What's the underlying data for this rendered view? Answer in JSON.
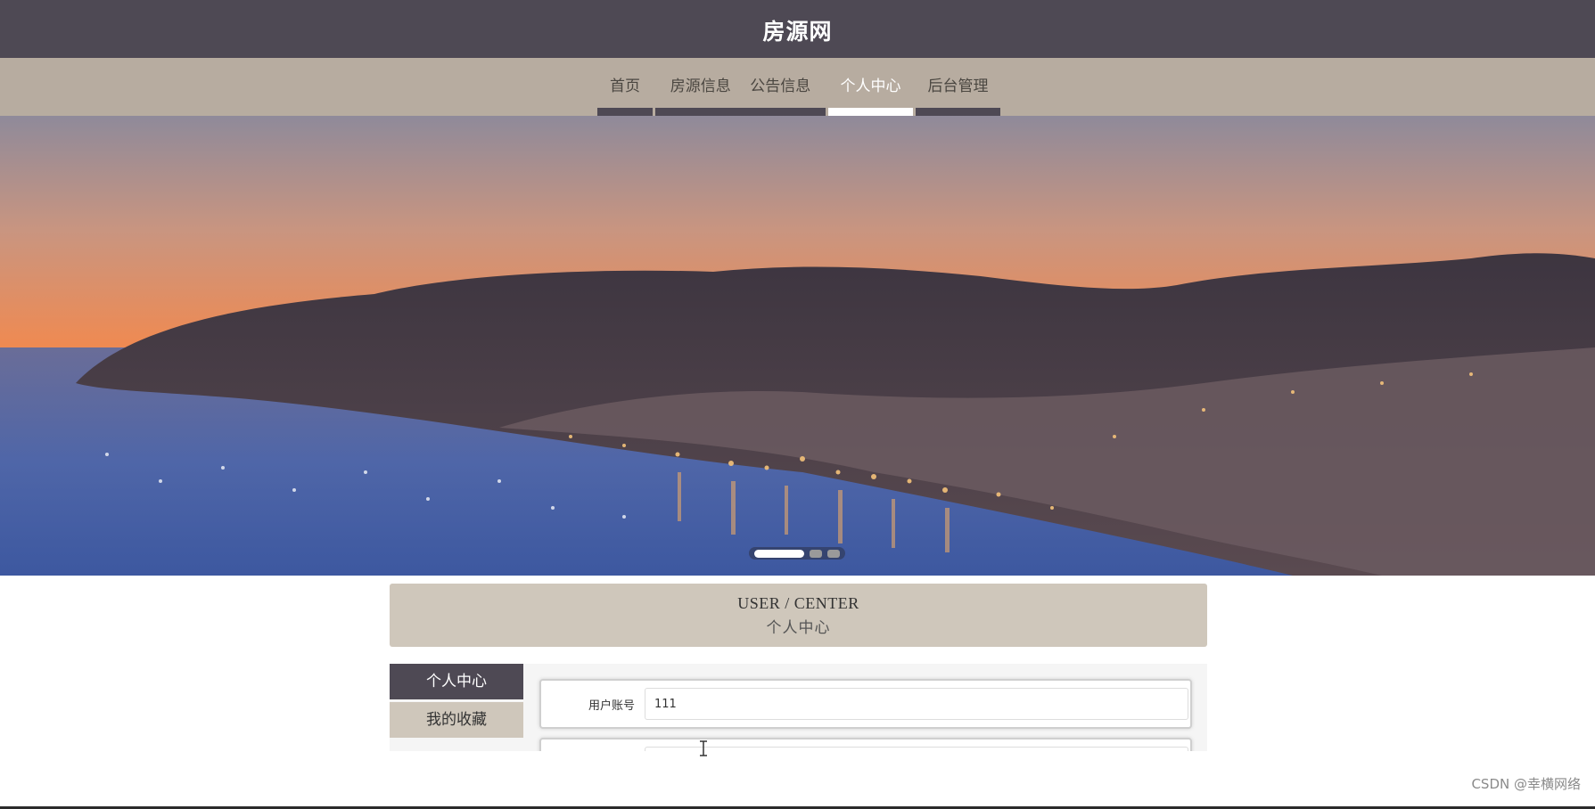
{
  "header": {
    "title": "房源网"
  },
  "nav": {
    "items": [
      {
        "label": "首页"
      },
      {
        "label": "房源信息"
      },
      {
        "label": "公告信息"
      },
      {
        "label": "个人中心"
      },
      {
        "label": "后台管理"
      }
    ],
    "active_index": 3
  },
  "banner": {
    "slide_count": 3,
    "active_slide": 0
  },
  "section": {
    "title_en": "USER / CENTER",
    "title_cn": "个人中心"
  },
  "sidebar": {
    "items": [
      {
        "label": "个人中心"
      },
      {
        "label": "我的收藏"
      }
    ],
    "active_index": 0
  },
  "form": {
    "fields": [
      {
        "label": "用户账号",
        "value": "111"
      }
    ]
  },
  "watermark": "CSDN @幸横网络",
  "colors": {
    "header_bg": "#4e4954",
    "nav_bg": "#b7aca0",
    "accent_beige": "#cfc7bb"
  }
}
